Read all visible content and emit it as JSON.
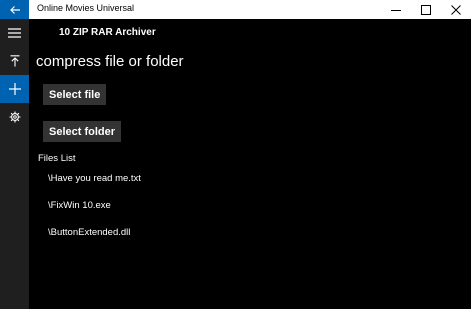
{
  "window": {
    "title": "Online Movies Universal",
    "controls": [
      "minimize-icon",
      "maximize-icon",
      "close-icon"
    ]
  },
  "sidebar": {
    "items": [
      {
        "name": "hamburger-menu",
        "icon": "hamburger-icon"
      },
      {
        "name": "upload",
        "icon": "upload-icon"
      },
      {
        "name": "add",
        "icon": "plus-icon",
        "active": true
      },
      {
        "name": "settings",
        "icon": "gear-icon"
      }
    ]
  },
  "main": {
    "app_name": "10 ZIP RAR Archiver",
    "page_title": "compress file or folder",
    "select_file_label": "Select file",
    "select_folder_label": "Select folder",
    "files_heading": "Files List",
    "files": [
      "\\Have you read me.txt",
      "\\FixWin 10.exe",
      "\\ButtonExtended.dll"
    ]
  },
  "colors": {
    "accent": "#0063b1",
    "sidebar_bg": "#1f1f1f",
    "button_bg": "#333333",
    "background": "#000000"
  }
}
